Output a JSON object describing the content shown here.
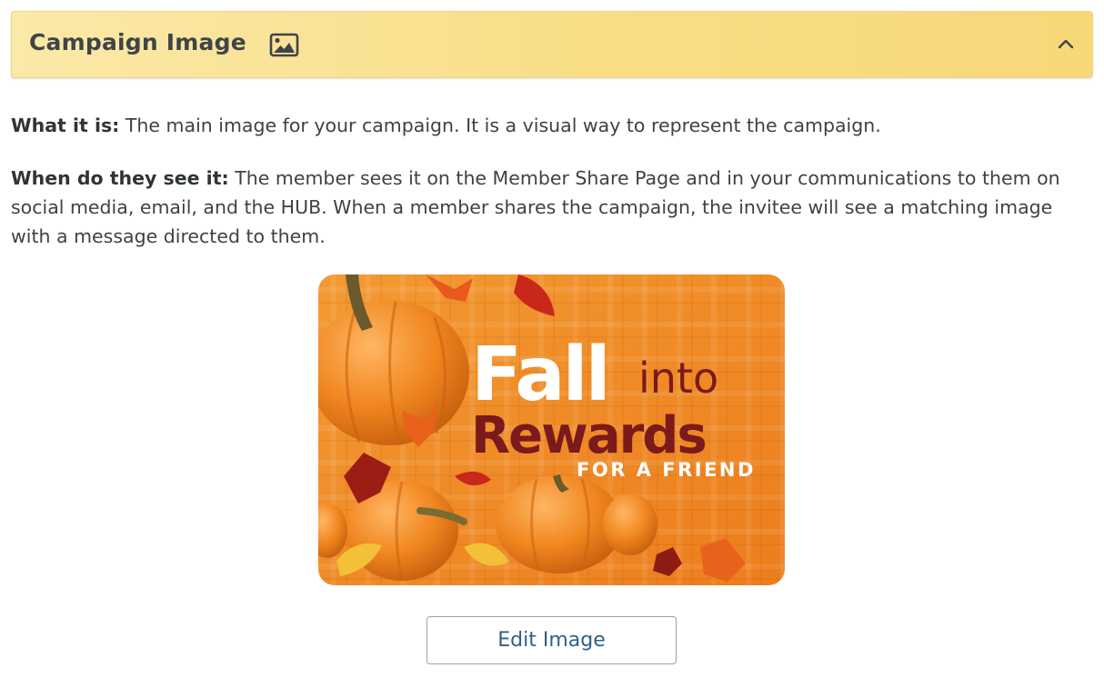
{
  "panel": {
    "title": "Campaign Image",
    "title_icon": "image-icon",
    "toggle_icon": "chevron-up-icon",
    "header_color": "#f9dd86"
  },
  "description": {
    "what_label": "What it is:",
    "what_text": " The main image for your campaign. It is a visual way to represent the campaign.",
    "when_label": "When do they see it:",
    "when_text": " The member sees it on the Member Share Page and in your communications to them on social media, email, and the HUB. When a member shares the campaign, the invitee will see a matching image with a message directed to them."
  },
  "campaign_image": {
    "headline_word1": "Fall",
    "headline_word2": "into",
    "headline_word3": "Rewards",
    "tagline": "FOR A FRIEND",
    "background_color": "#f08a24",
    "headline_white": "#ffffff",
    "headline_dark": "#7a1a1a"
  },
  "actions": {
    "edit_label": "Edit Image"
  }
}
